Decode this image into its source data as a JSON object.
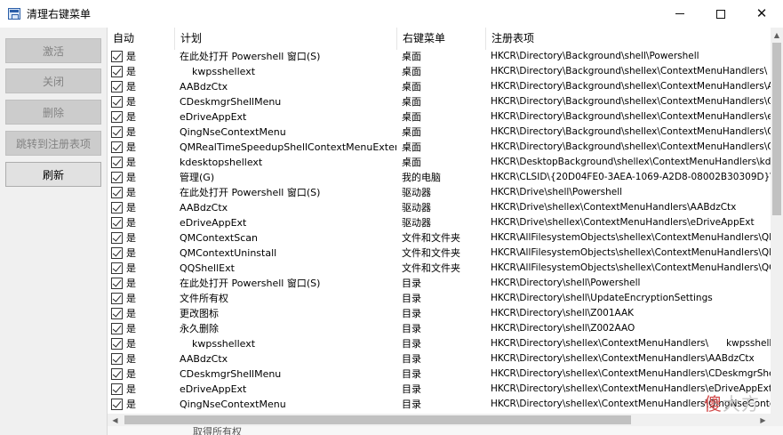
{
  "window": {
    "title": "清理右键菜单",
    "minimize_icon": "minimize-icon",
    "maximize_icon": "maximize-icon",
    "close_icon": "close-icon"
  },
  "sidebar": {
    "buttons": [
      {
        "label": "激活",
        "enabled": false
      },
      {
        "label": "关闭",
        "enabled": false
      },
      {
        "label": "删除",
        "enabled": false
      },
      {
        "label": "跳转到注册表项",
        "enabled": false
      },
      {
        "label": "刷新",
        "enabled": true
      }
    ]
  },
  "table": {
    "headers": [
      "自动",
      "计划",
      "右键菜单",
      "注册表项"
    ],
    "rows": [
      {
        "auto": "是",
        "plan": "在此处打开 Powershell 窗口(S)",
        "menu": "桌面",
        "reg": "HKCR\\Directory\\Background\\shell\\Powershell"
      },
      {
        "auto": "是",
        "plan": "    kwpsshellext",
        "menu": "桌面",
        "reg": "HKCR\\Directory\\Background\\shellex\\ContextMenuHandlers\\"
      },
      {
        "auto": "是",
        "plan": "AABdzCtx",
        "menu": "桌面",
        "reg": "HKCR\\Directory\\Background\\shellex\\ContextMenuHandlers\\AABdzCtx"
      },
      {
        "auto": "是",
        "plan": "CDeskmgrShellMenu",
        "menu": "桌面",
        "reg": "HKCR\\Directory\\Background\\shellex\\ContextMenuHandlers\\CDeskmgrShellMenu"
      },
      {
        "auto": "是",
        "plan": "eDriveAppExt",
        "menu": "桌面",
        "reg": "HKCR\\Directory\\Background\\shellex\\ContextMenuHandlers\\eDriveAppExt"
      },
      {
        "auto": "是",
        "plan": "QingNseContextMenu",
        "menu": "桌面",
        "reg": "HKCR\\Directory\\Background\\shellex\\ContextMenuHandlers\\QingNseContextMenu"
      },
      {
        "auto": "是",
        "plan": "QMRealTimeSpeedupShellContextMenuExtension",
        "menu": "桌面",
        "reg": "HKCR\\Directory\\Background\\shellex\\ContextMenuHandlers\\QMRealTimeSpeedup"
      },
      {
        "auto": "是",
        "plan": "kdesktopshellext",
        "menu": "桌面",
        "reg": "HKCR\\DesktopBackground\\shellex\\ContextMenuHandlers\\kdesktopshellext"
      },
      {
        "auto": "是",
        "plan": "管理(G)",
        "menu": "我的电脑",
        "reg": "HKCR\\CLSID\\{20D04FE0-3AEA-1069-A2D8-08002B30309D}\\shell"
      },
      {
        "auto": "是",
        "plan": "在此处打开 Powershell 窗口(S)",
        "menu": "驱动器",
        "reg": "HKCR\\Drive\\shell\\Powershell"
      },
      {
        "auto": "是",
        "plan": "AABdzCtx",
        "menu": "驱动器",
        "reg": "HKCR\\Drive\\shellex\\ContextMenuHandlers\\AABdzCtx"
      },
      {
        "auto": "是",
        "plan": "eDriveAppExt",
        "menu": "驱动器",
        "reg": "HKCR\\Drive\\shellex\\ContextMenuHandlers\\eDriveAppExt"
      },
      {
        "auto": "是",
        "plan": "QMContextScan",
        "menu": "文件和文件夹",
        "reg": "HKCR\\AllFilesystemObjects\\shellex\\ContextMenuHandlers\\QMContextScan"
      },
      {
        "auto": "是",
        "plan": "QMContextUninstall",
        "menu": "文件和文件夹",
        "reg": "HKCR\\AllFilesystemObjects\\shellex\\ContextMenuHandlers\\QMContextUninstall"
      },
      {
        "auto": "是",
        "plan": "QQShellExt",
        "menu": "文件和文件夹",
        "reg": "HKCR\\AllFilesystemObjects\\shellex\\ContextMenuHandlers\\QQShellExt"
      },
      {
        "auto": "是",
        "plan": "在此处打开 Powershell 窗口(S)",
        "menu": "目录",
        "reg": "HKCR\\Directory\\shell\\Powershell"
      },
      {
        "auto": "是",
        "plan": "文件所有权",
        "menu": "目录",
        "reg": "HKCR\\Directory\\shell\\UpdateEncryptionSettings"
      },
      {
        "auto": "是",
        "plan": "更改图标",
        "menu": "目录",
        "reg": "HKCR\\Directory\\shell\\Z001AAK"
      },
      {
        "auto": "是",
        "plan": "永久删除",
        "menu": "目录",
        "reg": "HKCR\\Directory\\shell\\Z002AAO"
      },
      {
        "auto": "是",
        "plan": "    kwpsshellext",
        "menu": "目录",
        "reg": "HKCR\\Directory\\shellex\\ContextMenuHandlers\\      kwpsshellext"
      },
      {
        "auto": "是",
        "plan": "AABdzCtx",
        "menu": "目录",
        "reg": "HKCR\\Directory\\shellex\\ContextMenuHandlers\\AABdzCtx"
      },
      {
        "auto": "是",
        "plan": "CDeskmgrShellMenu",
        "menu": "目录",
        "reg": "HKCR\\Directory\\shellex\\ContextMenuHandlers\\CDeskmgrShellMenu"
      },
      {
        "auto": "是",
        "plan": "eDriveAppExt",
        "menu": "目录",
        "reg": "HKCR\\Directory\\shellex\\ContextMenuHandlers\\eDriveAppExt"
      },
      {
        "auto": "是",
        "plan": "QingNseContextMenu",
        "menu": "目录",
        "reg": "HKCR\\Directory\\shellex\\ContextMenuHandlers\\QingNseContextMenu"
      }
    ]
  },
  "partial_bottom_text": "取得所有权",
  "watermark": {
    "first": "傻",
    "rest": "大方"
  }
}
